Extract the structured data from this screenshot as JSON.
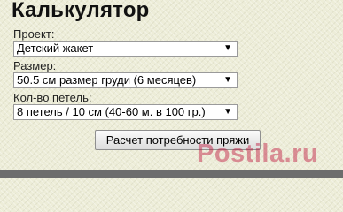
{
  "title": "Калькулятор",
  "fields": {
    "project": {
      "label": "Проект:",
      "value": "Детский жакет"
    },
    "size": {
      "label": "Размер:",
      "value": "50.5 см размер груди (6 месяцев)"
    },
    "stitches": {
      "label": "Кол-во петель:",
      "value": "8 петель / 10 см (40-60 м. в 100 гр.)"
    }
  },
  "button_label": "Расчет потребности пряжи",
  "watermark": "Postila.ru",
  "icons": {
    "dropdown": "chevron-down-icon"
  },
  "colors": {
    "background": "#ededd8",
    "footer": "#6d6d6d",
    "watermark": "#be143c"
  }
}
